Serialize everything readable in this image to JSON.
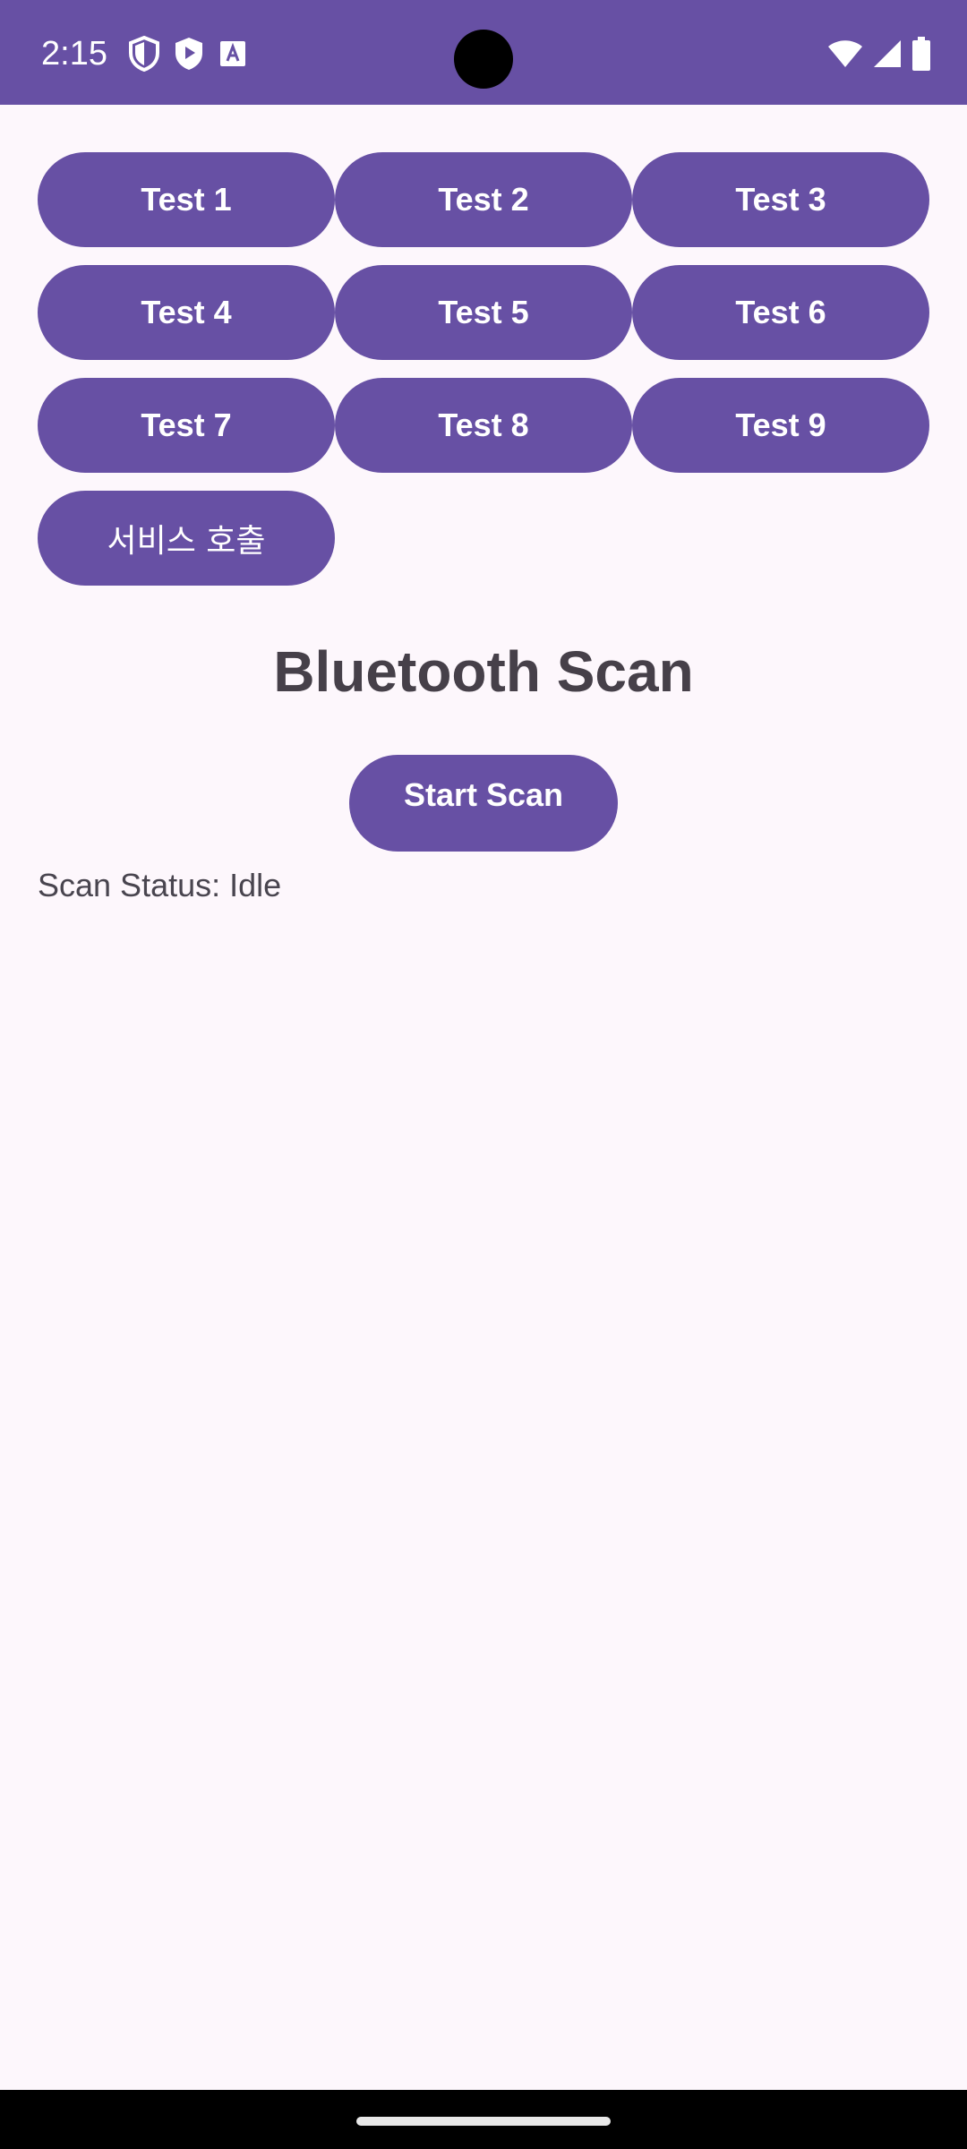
{
  "status_bar": {
    "time": "2:15",
    "background_color": "#6750a4",
    "left_icons": [
      "shield-icon",
      "play-shield-icon",
      "font-icon"
    ],
    "right_icons": [
      "wifi-icon",
      "cell-signal-icon",
      "battery-icon"
    ]
  },
  "buttons": [
    {
      "label": "Test 1"
    },
    {
      "label": "Test 2"
    },
    {
      "label": "Test 3"
    },
    {
      "label": "Test 4"
    },
    {
      "label": "Test 5"
    },
    {
      "label": "Test 6"
    },
    {
      "label": "Test 7"
    },
    {
      "label": "Test 8"
    },
    {
      "label": "Test 9"
    },
    {
      "label": "서비스 호출"
    }
  ],
  "main": {
    "title": "Bluetooth Scan",
    "start_scan_label": "Start Scan",
    "scan_status": "Scan Status: Idle"
  },
  "colors": {
    "accent": "#6750a4",
    "background": "#fdf7fc",
    "text": "#464049"
  }
}
